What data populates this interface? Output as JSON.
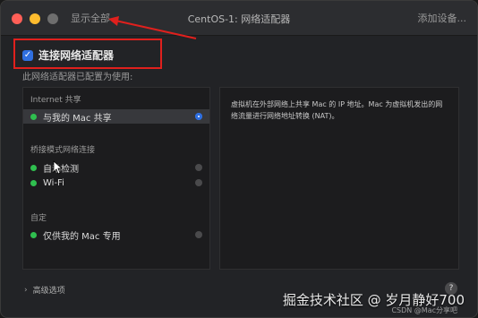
{
  "titlebar": {
    "show_all": "显示全部",
    "title": "CentOS-1: 网络适配器",
    "add_device": "添加设备..."
  },
  "connect": {
    "label": "连接网络适配器",
    "checked": true
  },
  "config_label": "此网络适配器已配置为使用:",
  "sections": {
    "internet": {
      "header": "Internet 共享",
      "options": [
        {
          "label": "与我的 Mac 共享",
          "selected": true
        }
      ]
    },
    "bridge": {
      "header": "桥接模式网络连接",
      "options": [
        {
          "label": "自动检测",
          "selected": false
        },
        {
          "label": "Wi-Fi",
          "selected": false
        }
      ]
    },
    "custom": {
      "header": "自定",
      "options": [
        {
          "label": "仅供我的 Mac 专用",
          "selected": false
        }
      ]
    }
  },
  "description": "虚拟机在外部网络上共享 Mac 的 IP 地址。Mac 为虚拟机发出的网络流量进行网络地址转换 (NAT)。",
  "advanced_label": "高级选项",
  "help_label": "?",
  "watermark": "掘金技术社区 @ 岁月静好700",
  "csdn": "CSDN @Mac分享吧",
  "colors": {
    "highlight": "#e0201d",
    "accent": "#2f6fe0",
    "status_green": "#2fbf4f"
  }
}
